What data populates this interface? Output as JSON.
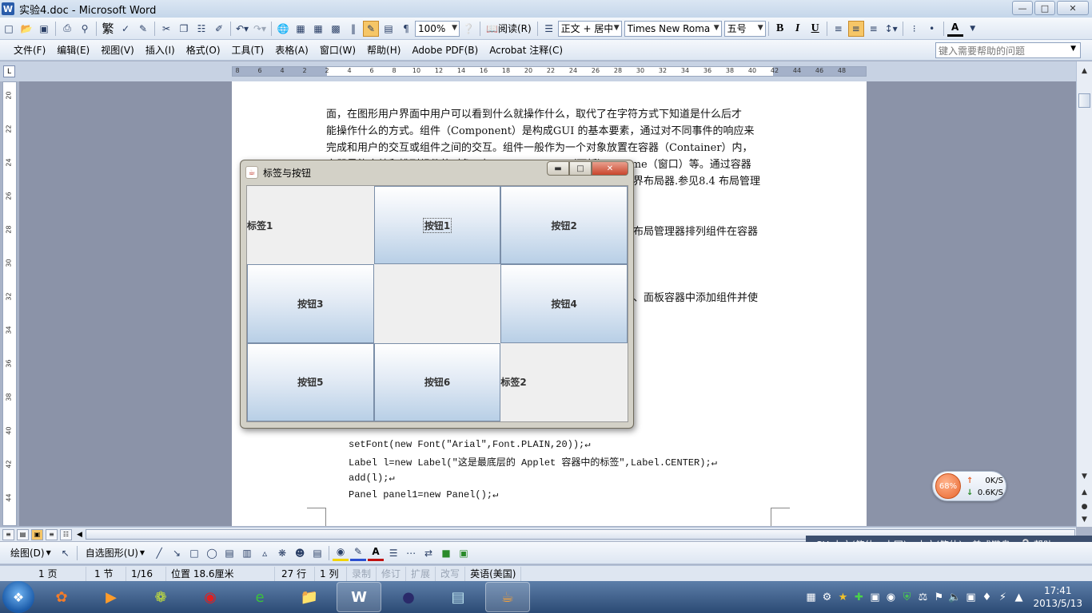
{
  "window": {
    "title": "实验4.doc - Microsoft Word",
    "ctrl_min": "—",
    "ctrl_max": "□",
    "ctrl_close": "✕"
  },
  "toolbar": {
    "traditional_label": "繁",
    "zoom": "100%",
    "read_label": "阅读(R)",
    "style": "正文 + 居中",
    "font": "Times New Roman",
    "size": "五号",
    "bold": "B",
    "italic": "I",
    "underline": "U",
    "font_color": "A"
  },
  "menu": {
    "items": [
      "文件(F)",
      "编辑(E)",
      "视图(V)",
      "插入(I)",
      "格式(O)",
      "工具(T)",
      "表格(A)",
      "窗口(W)",
      "帮助(H)",
      "Adobe PDF(B)",
      "Acrobat 注释(C)"
    ],
    "help_placeholder": "键入需要帮助的问题"
  },
  "ruler": {
    "h_ticks": [
      "8",
      "6",
      "4",
      "2",
      "2",
      "4",
      "6",
      "8",
      "10",
      "12",
      "14",
      "16",
      "18",
      "20",
      "22",
      "24",
      "26",
      "28",
      "30",
      "32",
      "34",
      "36",
      "38",
      "40",
      "42",
      "44",
      "46",
      "48"
    ],
    "v_ticks": [
      "20",
      "22",
      "24",
      "26",
      "28",
      "30",
      "32",
      "34",
      "36",
      "38",
      "40",
      "42",
      "44"
    ]
  },
  "document": {
    "lines": [
      "面，在图形用户界面中用户可以看到什么就操作什么，取代了在字符方式下知道是什么后才",
      "能操作什么的方式。组件（Component）是构成GUI 的基本要素，通过对不同事件的响应来",
      "完成和用户的交互或组件之间的交互。组件一般作为一个对象放置在容器（Container）内，",
      "容器是能容纳和排列组件的对象，如Applet、Panel（面板）、Frame（窗口）等。通过容器"
    ],
    "side_fragments": [
      "界布局器.参见8.4 布局管理",
      "布局管理器排列组件在容器",
      "、面板容器中添加组件并使"
    ],
    "code": [
      "setFont(new Font(\"Arial\",Font.PLAIN,20));↵",
      "Label l=new Label(\"这是最底层的 Applet 容器中的标签\",Label.CENTER);↵",
      "add(l);↵",
      "Panel panel1=new Panel();↵"
    ]
  },
  "java_frame": {
    "title": "标签与按钮",
    "cells": [
      {
        "kind": "label",
        "text": "标签1"
      },
      {
        "kind": "button",
        "text": "按钮1",
        "focused": true
      },
      {
        "kind": "button",
        "text": "按钮2"
      },
      {
        "kind": "button",
        "text": "按钮3"
      },
      {
        "kind": "empty",
        "text": ""
      },
      {
        "kind": "button",
        "text": "按钮4"
      },
      {
        "kind": "button",
        "text": "按钮5"
      },
      {
        "kind": "button",
        "text": "按钮6"
      },
      {
        "kind": "label",
        "text": "标签2"
      }
    ]
  },
  "drawbar": {
    "draw_label": "绘图(D)",
    "autoshape_label": "自选图形(U)"
  },
  "langbar": {
    "ime": "CH 中文(简体，中国)",
    "keyboard": "中文(简体) - 美式键盘",
    "help": "帮助"
  },
  "status": {
    "page": "1 页",
    "section": "1 节",
    "page_of": "1/16",
    "position": "位置 18.6厘米",
    "line": "27 行",
    "column": "1 列",
    "rec": "录制",
    "trk": "修订",
    "ext": "扩展",
    "ovr": "改写",
    "language": "英语(美国)"
  },
  "netwidget": {
    "percent": "68%",
    "up": "0K/S",
    "down": "0.6K/S"
  },
  "clock": {
    "time": "17:41",
    "date": "2013/5/13"
  }
}
